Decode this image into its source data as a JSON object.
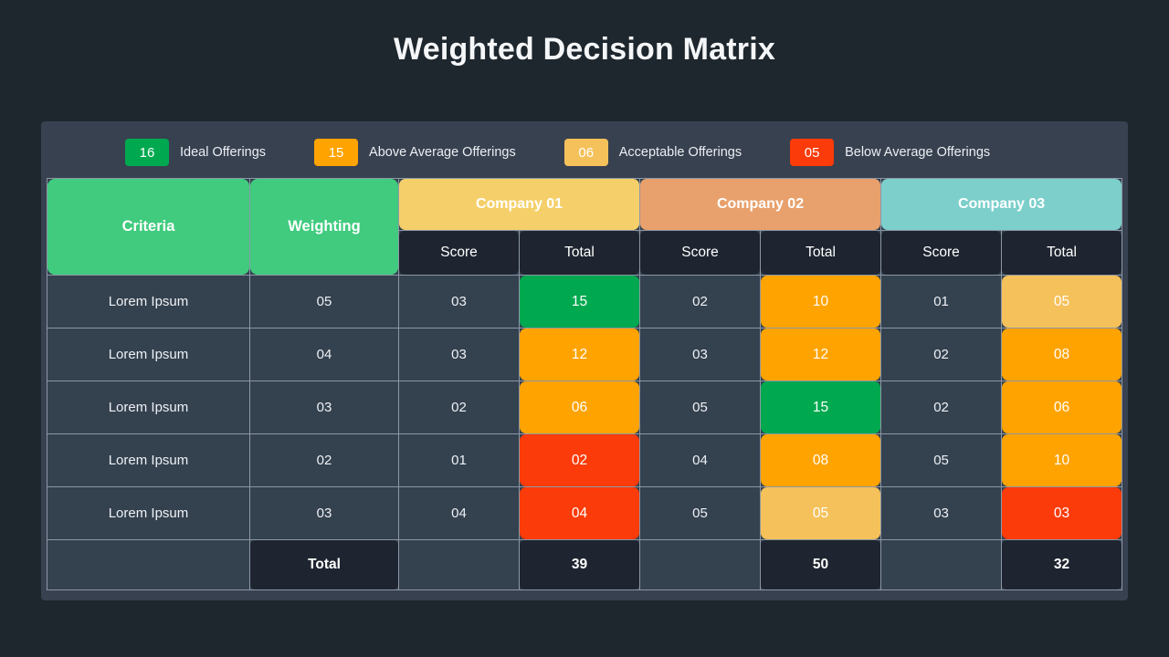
{
  "page": {
    "title": "Weighted Decision Matrix",
    "background_color": "#1e272e",
    "panel_color": "#384150"
  },
  "legend": {
    "items": [
      {
        "value": "16",
        "label": "Ideal Offerings",
        "color": "#00a94f"
      },
      {
        "value": "15",
        "label": "Above Average Offerings",
        "color": "#ffa300"
      },
      {
        "value": "06",
        "label": "Acceptable Offerings",
        "color": "#f5c15a"
      },
      {
        "value": "05",
        "label": "Below Average Offerings",
        "color": "#fb3b09"
      }
    ]
  },
  "table": {
    "headers": {
      "criteria": "Criteria",
      "weighting": "Weighting",
      "criteria_color": "#41cb7f",
      "weighting_color": "#41cb7f",
      "score": "Score",
      "total": "Total"
    },
    "companies": [
      {
        "name": "Company 01",
        "color": "#f5d06a"
      },
      {
        "name": "Company 02",
        "color": "#e8a16c"
      },
      {
        "name": "Company 03",
        "color": "#7ccfcb"
      }
    ],
    "rows": [
      {
        "criteria": "Lorem Ipsum",
        "weighting": "05",
        "cells": [
          {
            "score": "03",
            "total": "15",
            "total_color": "#00a94f"
          },
          {
            "score": "02",
            "total": "10",
            "total_color": "#ffa300"
          },
          {
            "score": "01",
            "total": "05",
            "total_color": "#f5c15a"
          }
        ]
      },
      {
        "criteria": "Lorem Ipsum",
        "weighting": "04",
        "cells": [
          {
            "score": "03",
            "total": "12",
            "total_color": "#ffa300"
          },
          {
            "score": "03",
            "total": "12",
            "total_color": "#ffa300"
          },
          {
            "score": "02",
            "total": "08",
            "total_color": "#ffa300"
          }
        ]
      },
      {
        "criteria": "Lorem Ipsum",
        "weighting": "03",
        "cells": [
          {
            "score": "02",
            "total": "06",
            "total_color": "#ffa300"
          },
          {
            "score": "05",
            "total": "15",
            "total_color": "#00a94f"
          },
          {
            "score": "02",
            "total": "06",
            "total_color": "#ffa300"
          }
        ]
      },
      {
        "criteria": "Lorem Ipsum",
        "weighting": "02",
        "cells": [
          {
            "score": "01",
            "total": "02",
            "total_color": "#fb3b09"
          },
          {
            "score": "04",
            "total": "08",
            "total_color": "#ffa300"
          },
          {
            "score": "05",
            "total": "10",
            "total_color": "#ffa300"
          }
        ]
      },
      {
        "criteria": "Lorem Ipsum",
        "weighting": "03",
        "cells": [
          {
            "score": "04",
            "total": "04",
            "total_color": "#fb3b09"
          },
          {
            "score": "05",
            "total": "05",
            "total_color": "#f5c15a"
          },
          {
            "score": "03",
            "total": "03",
            "total_color": "#fb3b09"
          }
        ]
      }
    ],
    "total_row": {
      "label": "Total",
      "totals": [
        "39",
        "50",
        "32"
      ]
    }
  }
}
